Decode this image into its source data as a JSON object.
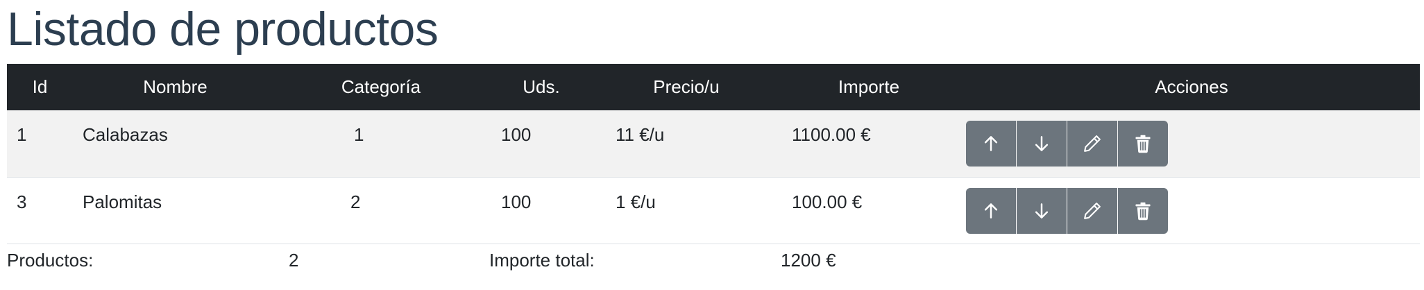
{
  "page": {
    "title": "Listado de productos"
  },
  "table": {
    "headers": {
      "id": "Id",
      "nombre": "Nombre",
      "categoria": "Categoría",
      "uds": "Uds.",
      "precio": "Precio/u",
      "importe": "Importe",
      "acciones": "Acciones"
    },
    "rows": [
      {
        "id": "1",
        "nombre": "Calabazas",
        "categoria": "1",
        "uds": "100",
        "precio": "11 €/u",
        "importe": "1100.00 €"
      },
      {
        "id": "3",
        "nombre": "Palomitas",
        "categoria": "2",
        "uds": "100",
        "precio": "1 €/u",
        "importe": "100.00 €"
      }
    ],
    "actions": {
      "up": "arrow-up-icon",
      "down": "arrow-down-icon",
      "edit": "pencil-icon",
      "delete": "trash-icon"
    }
  },
  "footer": {
    "productos_label": "Productos:",
    "productos_value": "2",
    "importe_label": "Importe total:",
    "importe_value": "1200 €"
  },
  "colors": {
    "header_bg": "#212529",
    "title": "#2c3e50",
    "button_bg": "#6c757d",
    "stripe": "#f2f2f2"
  }
}
